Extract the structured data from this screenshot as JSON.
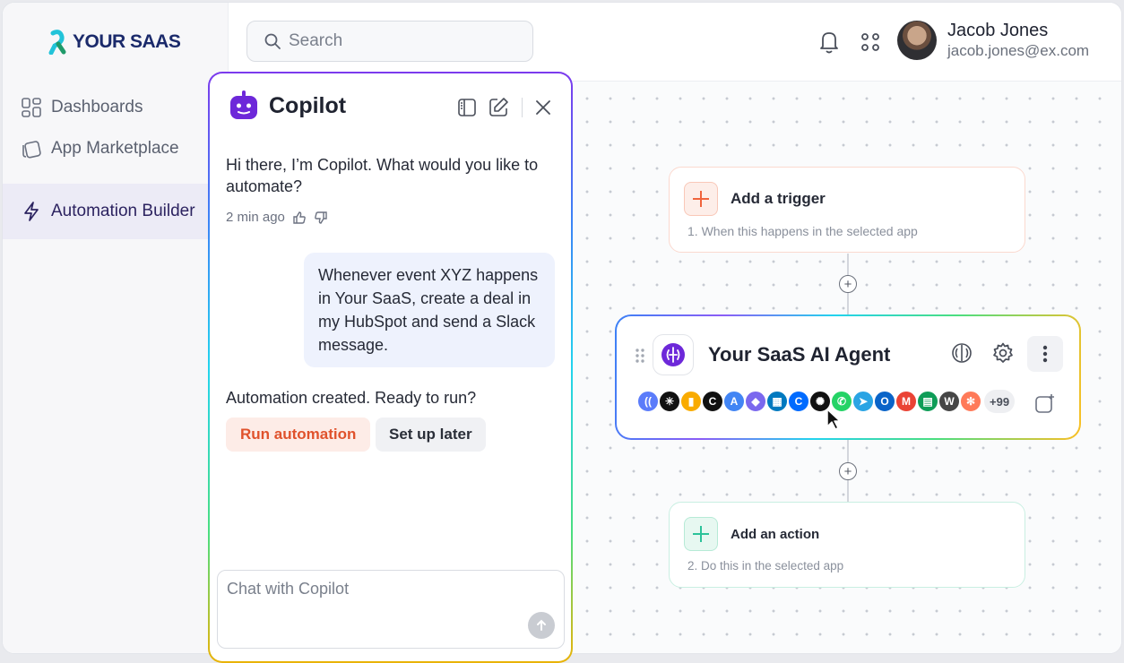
{
  "brand": {
    "name": "YOUR SAAS",
    "icon": "ribbon-logo-icon"
  },
  "sidebar": {
    "items": [
      {
        "label": "Dashboards",
        "icon": "grid-icon",
        "active": false
      },
      {
        "label": "App Marketplace",
        "icon": "cards-icon",
        "active": false
      },
      {
        "label": "Automation Builder",
        "icon": "sparkle-icon",
        "active": true
      }
    ]
  },
  "topbar": {
    "search_placeholder": "Search",
    "user": {
      "name": "Jacob Jones",
      "email": "jacob.jones@ex.com"
    }
  },
  "copilot": {
    "title": "Copilot",
    "greeting": "Hi there, I’m Copilot. What would you like to automate?",
    "timestamp": "2 min ago",
    "user_message": "Whenever event XYZ happens in Your SaaS, create a deal in my HubSpot and send a Slack message.",
    "status": "Automation created. Ready to run?",
    "run_label": "Run automation",
    "later_label": "Set up later",
    "input_placeholder": "Chat with Copilot"
  },
  "workflow": {
    "trigger": {
      "title": "Add a trigger",
      "subtitle": "1. When this happens in the selected app"
    },
    "agent": {
      "title": "Your SaaS AI Agent",
      "apps": [
        {
          "name": "stripe-like",
          "color": "#5b7cfa",
          "glyph": "(("
        },
        {
          "name": "perplexity",
          "color": "#111111",
          "glyph": "✳"
        },
        {
          "name": "google-analytics",
          "color": "#f9ab00",
          "glyph": "▮"
        },
        {
          "name": "cronitor",
          "color": "#111111",
          "glyph": "C"
        },
        {
          "name": "google-ads",
          "color": "#4285f4",
          "glyph": "A"
        },
        {
          "name": "clickup",
          "color": "#7b68ee",
          "glyph": "◆"
        },
        {
          "name": "trello",
          "color": "#0079bf",
          "glyph": "▦"
        },
        {
          "name": "calendly",
          "color": "#006bff",
          "glyph": "C"
        },
        {
          "name": "openai",
          "color": "#111111",
          "glyph": "✺"
        },
        {
          "name": "whatsapp",
          "color": "#25d366",
          "glyph": "✆"
        },
        {
          "name": "telegram",
          "color": "#2aa4e4",
          "glyph": "➤"
        },
        {
          "name": "outlook",
          "color": "#0a64c8",
          "glyph": "O"
        },
        {
          "name": "gmail",
          "color": "#ea4335",
          "glyph": "M"
        },
        {
          "name": "google-sheets",
          "color": "#0f9d58",
          "glyph": "▤"
        },
        {
          "name": "wordpress",
          "color": "#464646",
          "glyph": "W"
        },
        {
          "name": "hubspot",
          "color": "#ff7a59",
          "glyph": "✻"
        }
      ],
      "more_count": "+99"
    },
    "action": {
      "title": "Add an action",
      "subtitle": "2. Do this in the selected app"
    }
  }
}
